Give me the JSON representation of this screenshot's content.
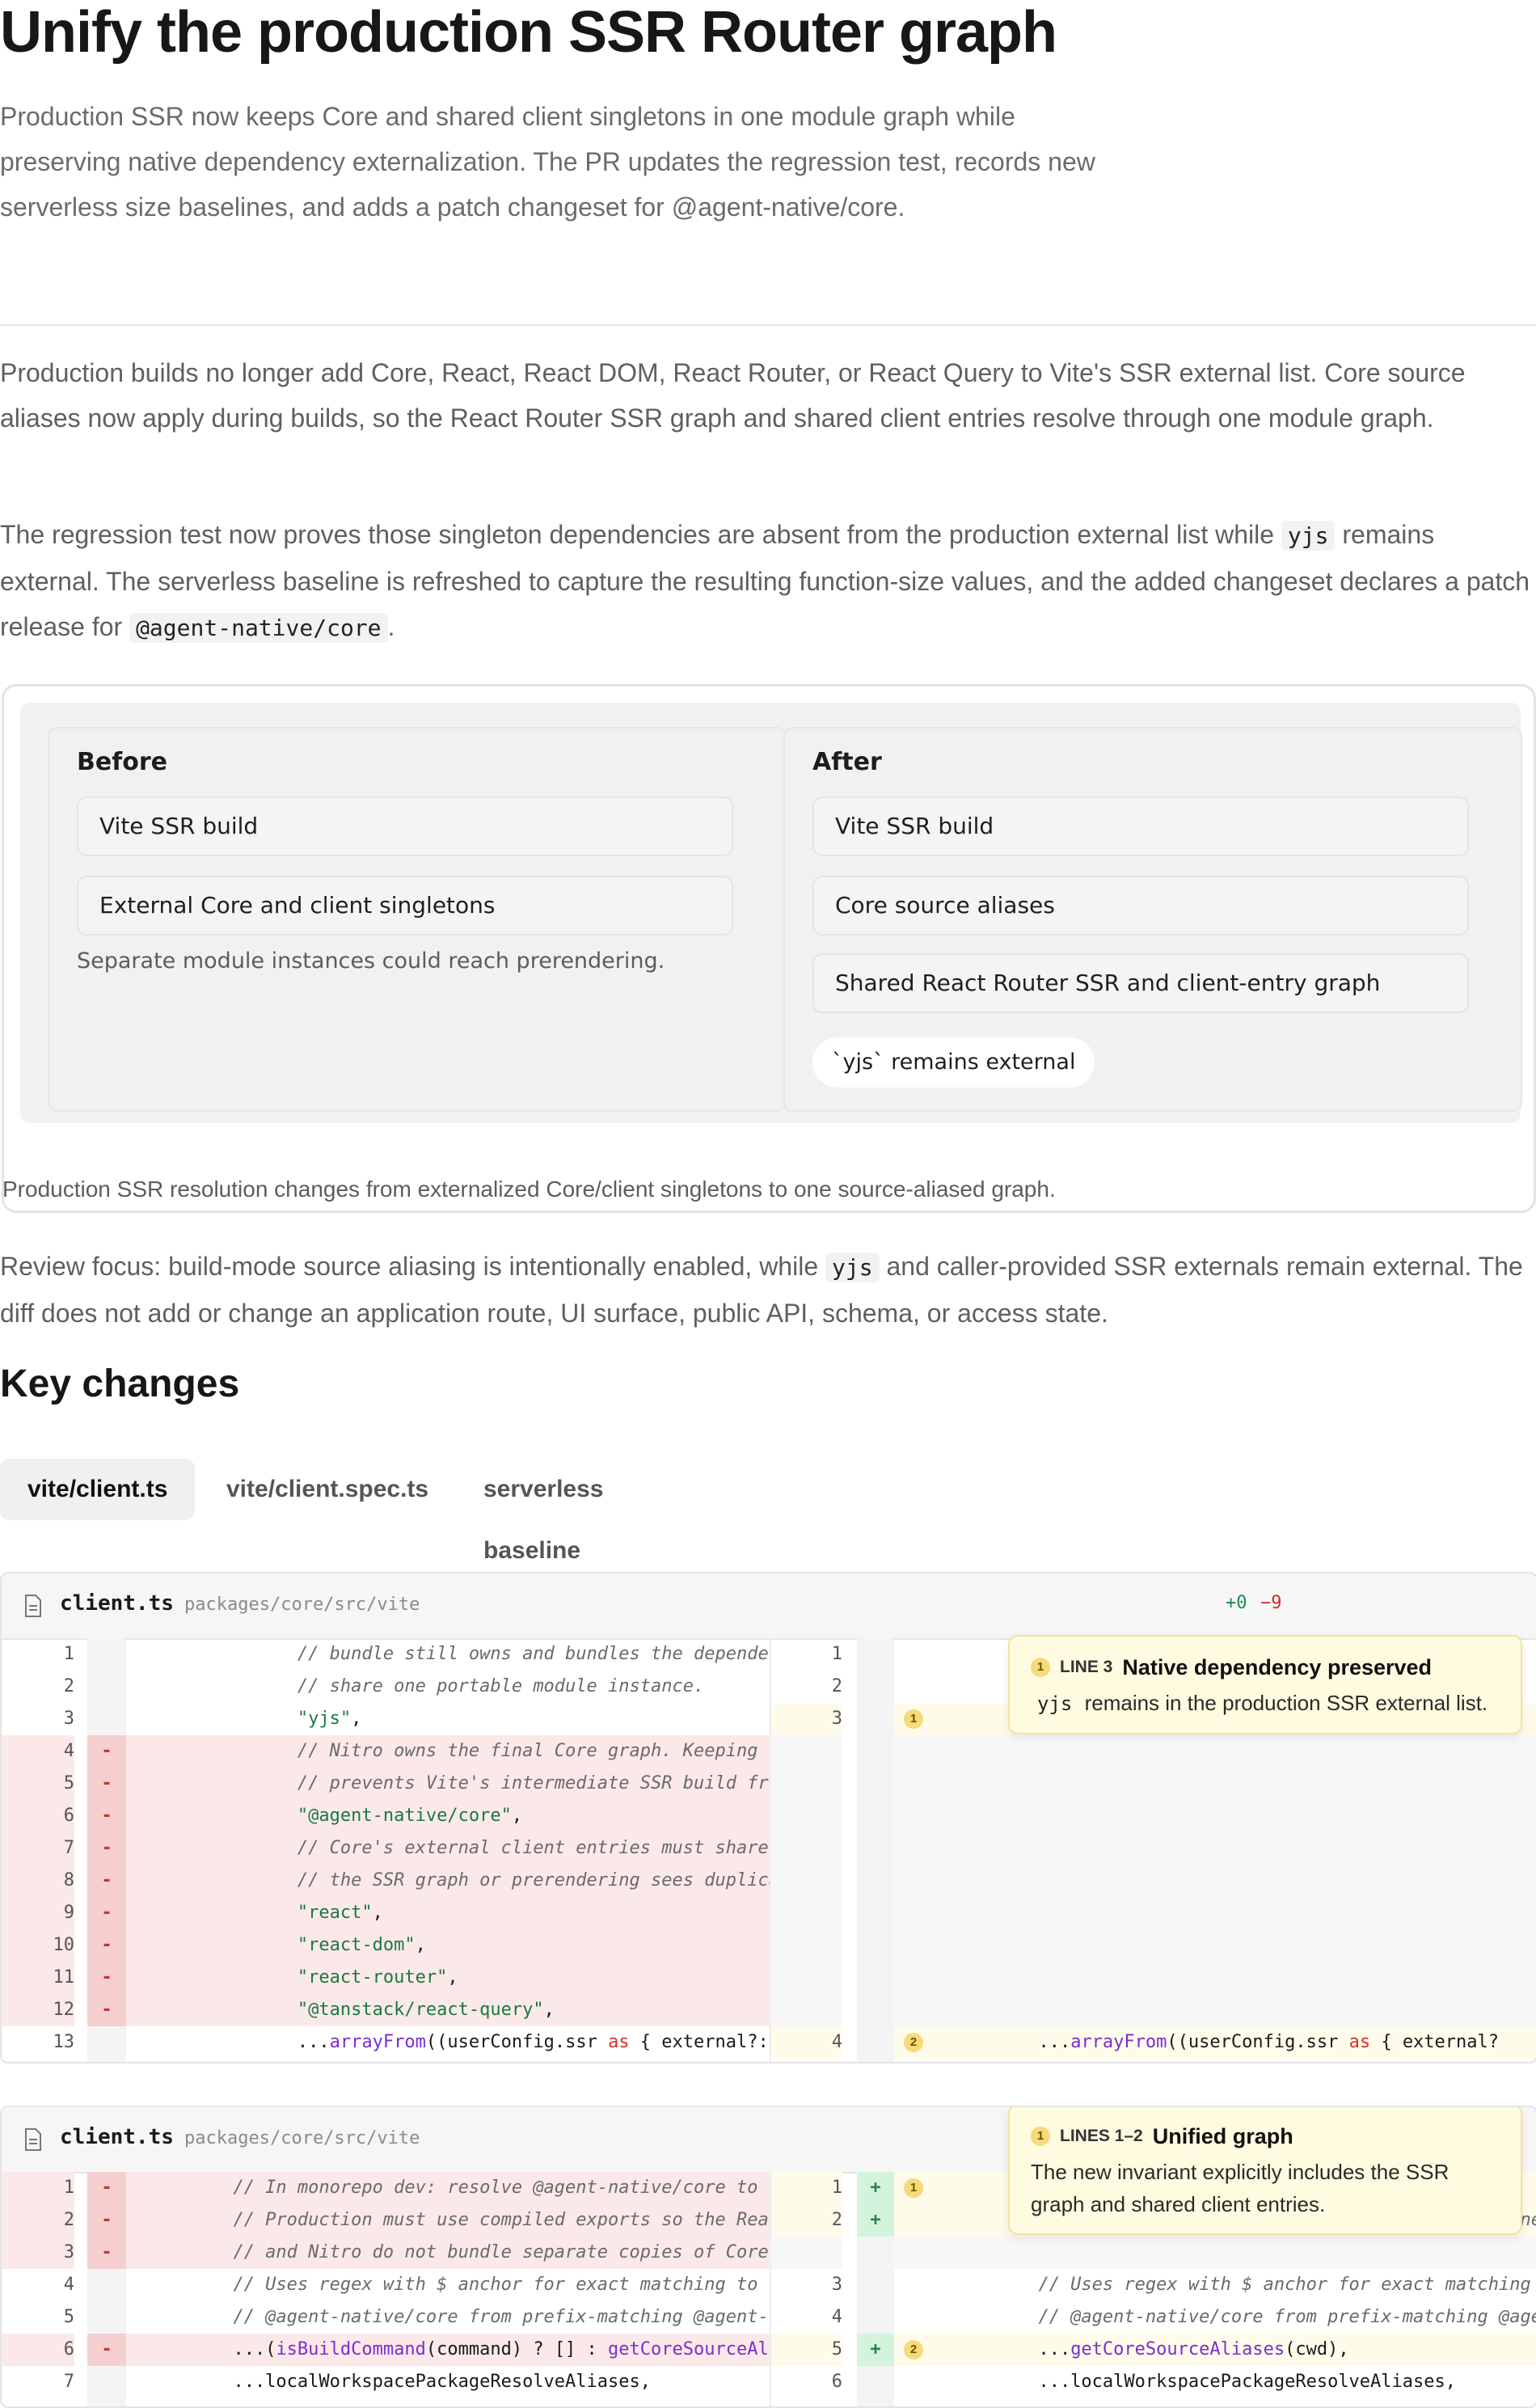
{
  "page": {
    "title": "Unify the production SSR Router graph",
    "summary": "Production SSR now keeps Core and shared client singletons in one module graph while preserving native dependency externalization. The PR updates the regression test, records new serverless size baselines, and adds a patch changeset for @agent-native/core.",
    "para1": "Production builds no longer add Core, React, React DOM, React Router, or React Query to Vite's SSR external list. Core source aliases now apply during builds, so the React Router SSR graph and shared client entries resolve through one module graph.",
    "para2_a": "The regression test now proves those singleton dependencies are absent from the production external list while ",
    "para2_code1": "yjs",
    "para2_b": " remains external. The serverless baseline is refreshed to capture the resulting function-size values, and the added changeset declares a patch release for ",
    "para2_code2": "@agent-native/core",
    "para2_c": ".",
    "review_a": "Review focus: build-mode source aliasing is intentionally enabled, while ",
    "review_code": "yjs",
    "review_b": " and caller-provided SSR externals remain external. The diff does not add or change an application route, UI surface, public API, schema, or access state."
  },
  "figure": {
    "before": {
      "title": "Before",
      "steps": [
        "Vite SSR build",
        "External Core and client singletons"
      ],
      "note": "Separate module instances could reach prerendering."
    },
    "after": {
      "title": "After",
      "steps": [
        "Vite SSR build",
        "Core source aliases",
        "Shared React Router SSR and client-entry graph"
      ],
      "pill": "`yjs` remains external"
    },
    "caption": "Production SSR resolution changes from externalized Core/client singletons to one source-aliased graph."
  },
  "key_changes": {
    "heading": "Key changes",
    "tabs": [
      "vite/client.ts",
      "vite/client.spec.ts",
      "serverless baseline"
    ]
  },
  "diff1": {
    "file": "client.ts",
    "path": "packages/core/src/vite",
    "added": "+0",
    "removed": "−9",
    "callout": {
      "badge": "1",
      "lines": "LINE 3",
      "title": "Native dependency preserved",
      "code": "yjs",
      "text": " remains in the production SSR external list."
    }
  },
  "diff2": {
    "file": "client.ts",
    "path": "packages/core/src/vite",
    "callout": {
      "badge": "1",
      "lines": "LINES 1–2",
      "title": "Unified graph",
      "text": "The new invariant explicitly includes the SSR graph and shared client entries."
    }
  }
}
